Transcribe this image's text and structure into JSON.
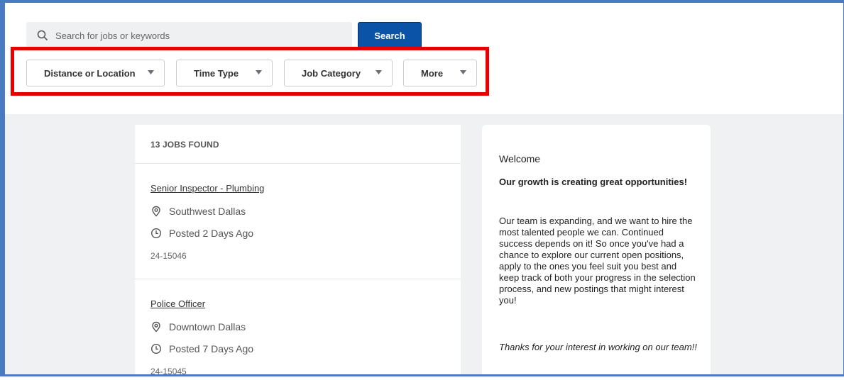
{
  "search": {
    "placeholder": "Search for jobs or keywords",
    "button_label": "Search"
  },
  "filters": [
    {
      "label": "Distance or Location"
    },
    {
      "label": "Time Type"
    },
    {
      "label": "Job Category"
    },
    {
      "label": "More"
    }
  ],
  "results": {
    "count_label": "13 JOBS FOUND",
    "jobs": [
      {
        "title": "Senior Inspector - Plumbing",
        "location": "Southwest Dallas",
        "posted": "Posted 2 Days Ago",
        "id": "24-15046"
      },
      {
        "title": "Police Officer",
        "location": "Downtown Dallas",
        "posted": "Posted 7 Days Ago",
        "id": "24-15045"
      }
    ]
  },
  "welcome_panel": {
    "heading": "Welcome",
    "subheading": "Our growth is creating great opportunities!",
    "body": "Our team is expanding, and we want to hire the most talented people we can. Continued success depends on it! So once you've had a chance to explore our current open positions, apply to the ones you feel suit you best and keep track of both your progress in the selection process, and new postings that might interest you!",
    "closing": "Thanks for your interest in working on our team!!"
  },
  "colors": {
    "accent": "#0a53a6",
    "highlight": "#e60000",
    "frame": "#4a7bc0"
  }
}
